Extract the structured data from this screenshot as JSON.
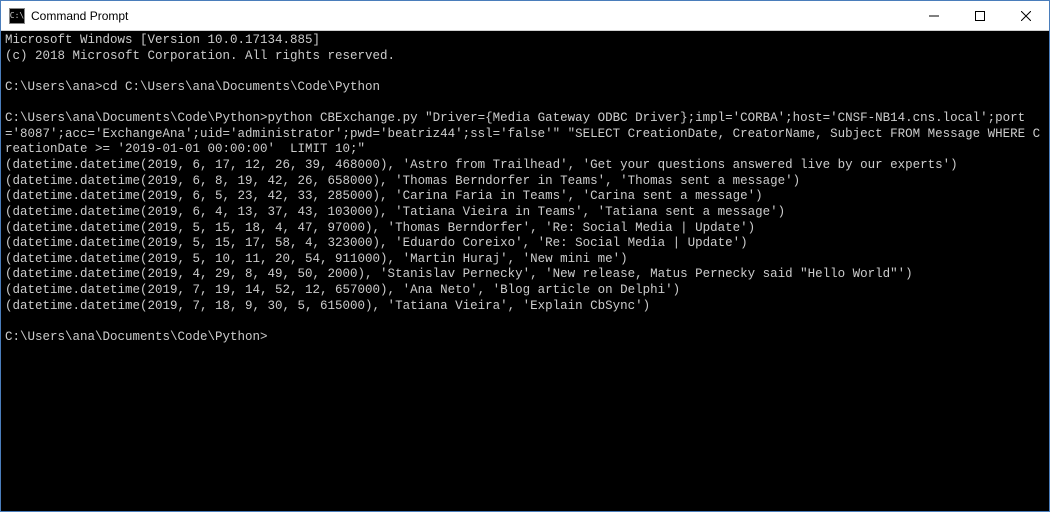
{
  "titlebar": {
    "icon_label": "C:\\",
    "title": "Command Prompt"
  },
  "console": {
    "header_line1": "Microsoft Windows [Version 10.0.17134.885]",
    "header_line2": "(c) 2018 Microsoft Corporation. All rights reserved.",
    "prompt1": "C:\\Users\\ana>cd C:\\Users\\ana\\Documents\\Code\\Python",
    "prompt2_prefix": "C:\\Users\\ana\\Documents\\Code\\Python>",
    "command": "python CBExchange.py \"Driver={Media Gateway ODBC Driver};impl='CORBA';host='CNSF-NB14.cns.local';port='8087';acc='ExchangeAna';uid='administrator';pwd='beatriz44';ssl='false'\" \"SELECT CreationDate, CreatorName, Subject FROM Message WHERE CreationDate >= '2019-01-01 00:00:00'  LIMIT 10;\"",
    "output": [
      "(datetime.datetime(2019, 6, 17, 12, 26, 39, 468000), 'Astro from Trailhead', 'Get your questions answered live by our experts')",
      "(datetime.datetime(2019, 6, 8, 19, 42, 26, 658000), 'Thomas Berndorfer in Teams', 'Thomas sent a message')",
      "(datetime.datetime(2019, 6, 5, 23, 42, 33, 285000), 'Carina Faria in Teams', 'Carina sent a message')",
      "(datetime.datetime(2019, 6, 4, 13, 37, 43, 103000), 'Tatiana Vieira in Teams', 'Tatiana sent a message')",
      "(datetime.datetime(2019, 5, 15, 18, 4, 47, 97000), 'Thomas Berndorfer', 'Re: Social Media | Update')",
      "(datetime.datetime(2019, 5, 15, 17, 58, 4, 323000), 'Eduardo Coreixo', 'Re: Social Media | Update')",
      "(datetime.datetime(2019, 5, 10, 11, 20, 54, 911000), 'Martin Huraj', 'New mini me')",
      "(datetime.datetime(2019, 4, 29, 8, 49, 50, 2000), 'Stanislav Pernecky', 'New release, Matus Pernecky said \"Hello World\"')",
      "(datetime.datetime(2019, 7, 19, 14, 52, 12, 657000), 'Ana Neto', 'Blog article on Delphi')",
      "(datetime.datetime(2019, 7, 18, 9, 30, 5, 615000), 'Tatiana Vieira', 'Explain CbSync')"
    ],
    "prompt3": "C:\\Users\\ana\\Documents\\Code\\Python>"
  }
}
